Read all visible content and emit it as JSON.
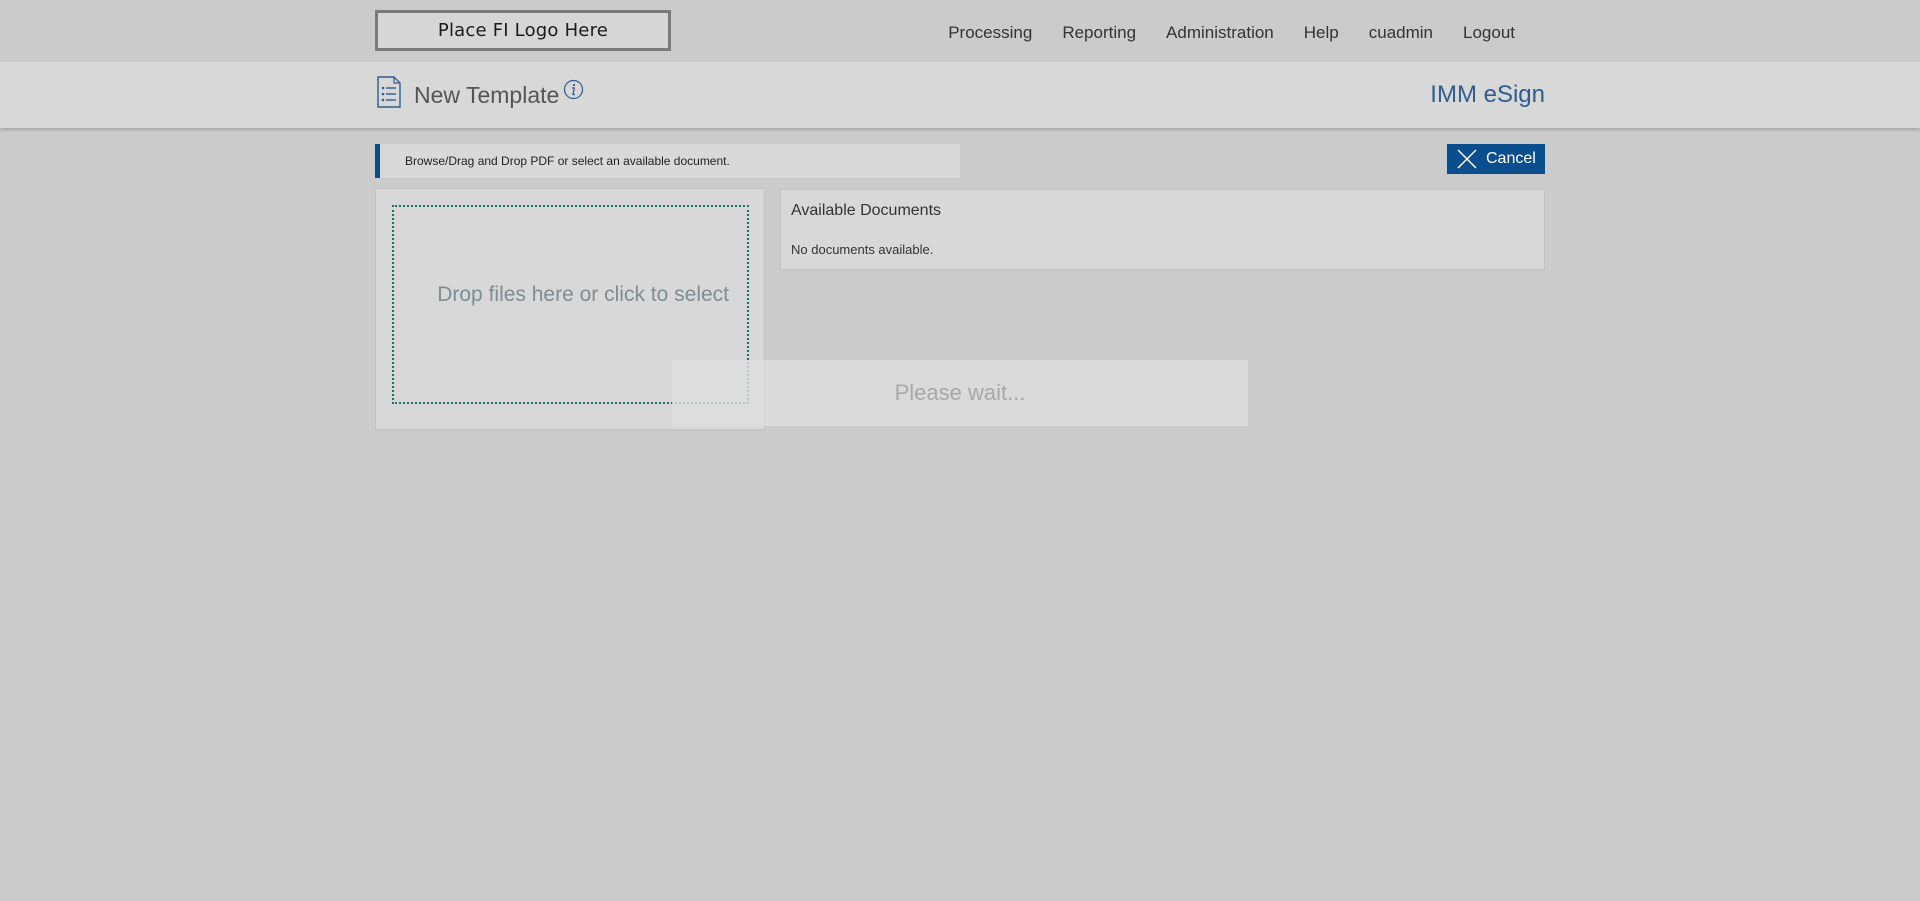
{
  "header": {
    "logo_text": "Place FI Logo Here",
    "nav": [
      {
        "label": "Processing"
      },
      {
        "label": "Reporting"
      },
      {
        "label": "Administration"
      },
      {
        "label": "Help"
      },
      {
        "label": "cuadmin"
      },
      {
        "label": "Logout"
      }
    ]
  },
  "subheader": {
    "icon": "document-list-icon",
    "title": "New Template",
    "info_icon": "info-icon",
    "brand": "IMM eSign"
  },
  "instruction": {
    "text": "Browse/Drag and Drop PDF or select an available document."
  },
  "cancel": {
    "label": "Cancel",
    "icon": "close-icon"
  },
  "dropzone": {
    "text": "Drop files here or click to select"
  },
  "documents": {
    "title": "Available Documents",
    "empty_text": "No documents available."
  },
  "overlay": {
    "text": "Please wait..."
  },
  "colors": {
    "accent": "#0b4e8e",
    "brand": "#2e5d8f",
    "dropzone_border": "#1f6f72",
    "background": "#cbcbcb"
  }
}
